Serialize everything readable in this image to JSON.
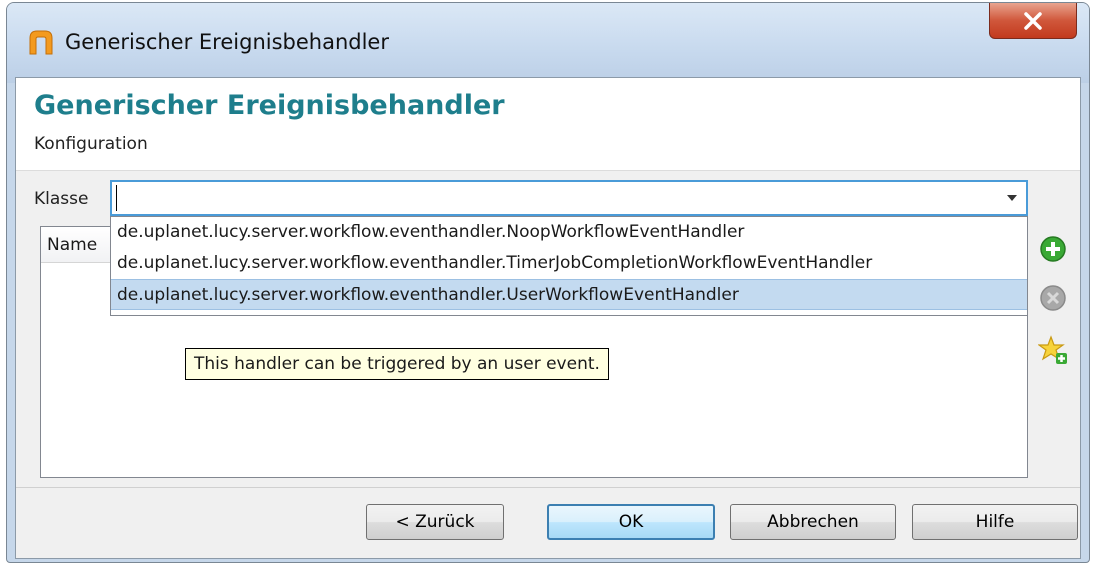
{
  "window": {
    "title": "Generischer Ereignisbehandler"
  },
  "header": {
    "title": "Generischer Ereignisbehandler",
    "subtitle": "Konfiguration"
  },
  "klasse": {
    "label": "Klasse",
    "value": ""
  },
  "table": {
    "columns": [
      "Name"
    ]
  },
  "dropdown": {
    "items": [
      "de.uplanet.lucy.server.workflow.eventhandler.NoopWorkflowEventHandler",
      "de.uplanet.lucy.server.workflow.eventhandler.TimerJobCompletionWorkflowEventHandler",
      "de.uplanet.lucy.server.workflow.eventhandler.UserWorkflowEventHandler"
    ],
    "selected_index": 2
  },
  "tooltip": "This handler can be triggered by an user event.",
  "side_buttons": [
    "add-icon",
    "remove-icon",
    "star-add-icon"
  ],
  "footer": {
    "back": "< Zurück",
    "ok": "OK",
    "cancel": "Abbrechen",
    "help": "Hilfe"
  }
}
